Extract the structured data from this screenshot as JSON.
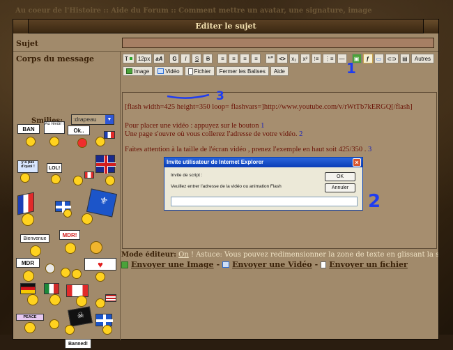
{
  "page": {
    "breadcrumb": "Au coeur de l'Histoire :: Aide du Forum :: Comment mettre un avatar, une signature, image"
  },
  "form": {
    "title": "Editer le sujet",
    "subject_label": "Sujet",
    "subject_value": "",
    "body_label": "Corps du message",
    "smilies_label": "Smilies:",
    "smilies_selected": ":drapeau"
  },
  "toolbar": {
    "row1": {
      "font_size": "12px",
      "bold": "G",
      "italic": "I",
      "underline": "S",
      "strike": "B",
      "quote": "“”",
      "code": "<>",
      "sub": "x₂",
      "sup": "x²",
      "others": "Autres"
    },
    "row2": {
      "image": "Image",
      "video": "Vidéo",
      "file": "Fichier",
      "close_tags": "Fermer les Balises",
      "help": "Aide"
    }
  },
  "editor": {
    "line1": "[flash width=425 height=350 loop= flashvars=]http://www.youtube.com/v/rWtTb7kERGQ[/flash]",
    "line2": "Pour placer une vidéo : appuyez sur le bouton ",
    "line2_num": "1",
    "line3": "Une page s'ouvre où vous collerez l'adresse de votre vidéo. ",
    "line3_num": "2",
    "line4": "Faites attention à la taille de l'écran vidéo , prenez l'exemple en haut soit 425/350 . ",
    "line4_num": "3"
  },
  "footer": {
    "mode_label": "Mode éditeur:",
    "mode_value": "On",
    "tip": "! Astuce: Vous pouvez redimensionner la zone de texte en glissant la souris sur ce texte.",
    "upload_image": "Envoyer une Image",
    "upload_video": "Envoyer une Vidéo",
    "upload_file": "Envoyer un fichier",
    "sep": "-"
  },
  "dialog": {
    "title": "Invite utilisateur de Internet Explorer",
    "line1": "Invite de script :",
    "line2": "Veuillez entrer l'adresse de la vidéo ou animation Flash",
    "ok": "OK",
    "cancel": "Annuler",
    "input_value": ""
  },
  "annotations": {
    "one": "1",
    "two": "2",
    "three": "3"
  },
  "smilies": {
    "ban": "BAN",
    "aurevoir": "Au revoir !",
    "ok": "Ok..",
    "yapas": "y a pas d'quoi !",
    "lol": "LOL!",
    "bienvenue": "Bienvenue",
    "mdr1": "MDR!",
    "mdr2": "MDR",
    "peace": "PEACE",
    "banned": "Banned!"
  },
  "colors": {
    "accent_annotation": "#1f3df0",
    "editor_text": "#6a1206",
    "label_text": "#3a2108"
  }
}
